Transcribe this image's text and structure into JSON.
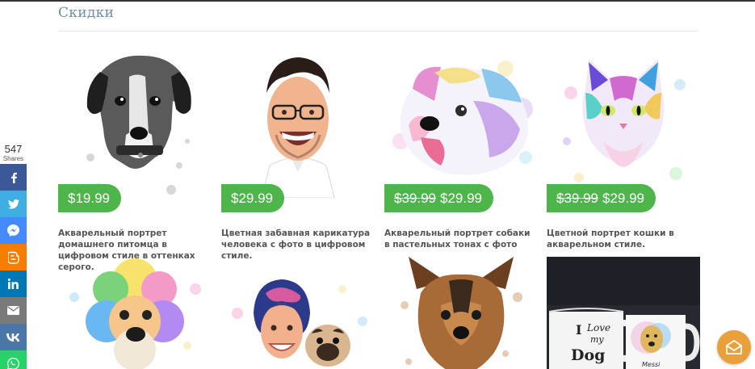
{
  "section": {
    "title": "Скидки"
  },
  "share": {
    "count": "547",
    "label": "Shares",
    "buttons": [
      {
        "name": "facebook",
        "icon": "facebook-icon",
        "color": "#3b5998"
      },
      {
        "name": "twitter",
        "icon": "twitter-icon",
        "color": "#3eaee3"
      },
      {
        "name": "messenger",
        "icon": "messenger-icon",
        "color": "#448aff"
      },
      {
        "name": "blogger",
        "icon": "blogger-icon",
        "color": "#f57d00"
      },
      {
        "name": "linkedin",
        "icon": "linkedin-icon",
        "color": "#0077b5"
      },
      {
        "name": "email",
        "icon": "email-icon",
        "color": "#7a7a7a"
      },
      {
        "name": "vk",
        "icon": "vk-icon",
        "color": "#4a76a8"
      },
      {
        "name": "whatsapp",
        "icon": "whatsapp-icon",
        "color": "#25d366"
      }
    ]
  },
  "accent_color": "#4db54a",
  "products": [
    {
      "image": "dog-portrait-grayscale",
      "old_price": "",
      "price": "$19.99",
      "title": "Акварельный портрет домашнего питомца в цифровом стиле в оттенках серого."
    },
    {
      "image": "man-caricature",
      "old_price": "",
      "price": "$29.99",
      "title": "Цветная забавная карикатура человека с фото в цифровом стиле."
    },
    {
      "image": "dog-pastel-watercolor",
      "old_price": "$39.99",
      "price": "$29.99",
      "title": "Акварельный портрет собаки в пастельных тонах с фото"
    },
    {
      "image": "cat-watercolor",
      "old_price": "$39.99",
      "price": "$29.99",
      "title": "Цветной портрет кошки в акварельном стиле."
    },
    {
      "image": "poodle-rainbow-watercolor",
      "old_price": "",
      "price": "",
      "title": ""
    },
    {
      "image": "woman-with-pug-caricature",
      "old_price": "",
      "price": "",
      "title": ""
    },
    {
      "image": "yorkshire-terrier-watercolor",
      "old_price": "",
      "price": "",
      "title": ""
    },
    {
      "image": "mugs-i-love-my-dog",
      "old_price": "",
      "price": "",
      "title": "",
      "mug_text": [
        "I",
        "Love",
        "my",
        "Dog"
      ],
      "mug_name": "Messi"
    }
  ],
  "chat": {
    "icon": "chat-envelope-icon",
    "color": "#e9a03a"
  }
}
